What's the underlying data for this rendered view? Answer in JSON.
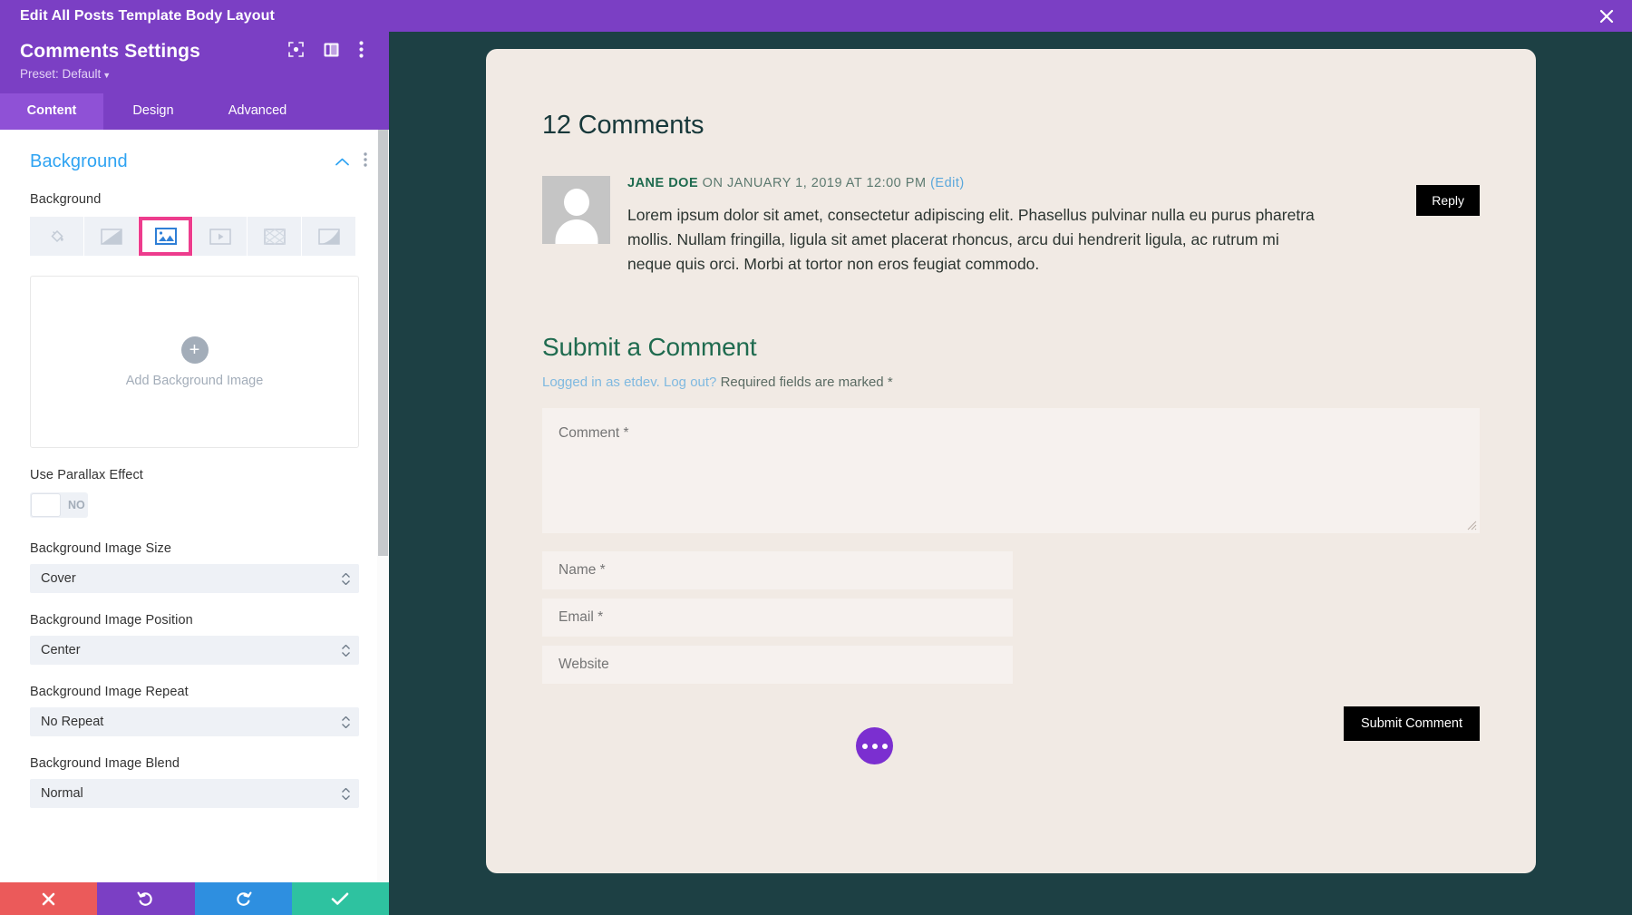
{
  "topbar": {
    "title": "Edit All Posts Template Body Layout",
    "close_icon": "close-icon"
  },
  "panel": {
    "header": {
      "title": "Comments Settings",
      "preset_label": "Preset: Default",
      "icons": [
        "focus-target-icon",
        "panel-layout-icon",
        "more-vertical-icon"
      ]
    },
    "tabs": [
      {
        "label": "Content",
        "active": true
      },
      {
        "label": "Design",
        "active": false
      },
      {
        "label": "Advanced",
        "active": false
      }
    ],
    "section": {
      "title": "Background",
      "collapse_icon": "chevron-up-icon",
      "more_icon": "more-vertical-icon"
    },
    "background_field": {
      "label": "Background",
      "types": [
        {
          "name": "background-color-icon",
          "selected": false
        },
        {
          "name": "background-gradient-icon",
          "selected": false
        },
        {
          "name": "background-image-icon",
          "selected": true
        },
        {
          "name": "background-video-icon",
          "selected": false
        },
        {
          "name": "background-pattern-icon",
          "selected": false
        },
        {
          "name": "background-mask-icon",
          "selected": false
        }
      ]
    },
    "upload": {
      "plus": "+",
      "label": "Add Background Image"
    },
    "parallax": {
      "label": "Use Parallax Effect",
      "value": "NO"
    },
    "selects": [
      {
        "label": "Background Image Size",
        "value": "Cover"
      },
      {
        "label": "Background Image Position",
        "value": "Center"
      },
      {
        "label": "Background Image Repeat",
        "value": "No Repeat"
      },
      {
        "label": "Background Image Blend",
        "value": "Normal"
      }
    ],
    "actions": [
      {
        "name": "cancel-button",
        "icon": "close-icon",
        "color": "#eb5a5a"
      },
      {
        "name": "undo-button",
        "icon": "undo-icon",
        "color": "#7b3fc4"
      },
      {
        "name": "redo-button",
        "icon": "redo-icon",
        "color": "#2e8fe0"
      },
      {
        "name": "save-button",
        "icon": "check-icon",
        "color": "#2ec2a0"
      }
    ]
  },
  "preview": {
    "comments_title": "12 Comments",
    "comment": {
      "author": "JANE DOE",
      "meta": " ON JANUARY 1, 2019 AT 12:00 PM ",
      "edit": "(Edit)",
      "body": "Lorem ipsum dolor sit amet, consectetur adipiscing elit. Phasellus pulvinar nulla eu purus pharetra mollis. Nullam fringilla, ligula sit amet placerat rhoncus, arcu dui hendrerit ligula, ac rutrum mi neque quis orci. Morbi at tortor non eros feugiat commodo.",
      "reply_label": "Reply"
    },
    "form": {
      "title": "Submit a Comment",
      "logged_in_prefix": "Logged in as etdev.",
      "logout_label": "Log out?",
      "required_note": "Required fields are marked *",
      "comment_placeholder": "Comment *",
      "name_placeholder": "Name *",
      "email_placeholder": "Email *",
      "website_placeholder": "Website",
      "submit_label": "Submit Comment"
    },
    "fab": "more-options-fab"
  },
  "colors": {
    "purple": "#7b3fc4",
    "purple_active_tab": "#8f51d6",
    "accent_blue": "#2ea3f2",
    "highlight_pink": "#ed3c8d",
    "preview_bg": "#1d4044",
    "card_bg": "#f1eae4",
    "heading_green": "#1f6b4f",
    "link_blue": "#7fb9e0"
  }
}
